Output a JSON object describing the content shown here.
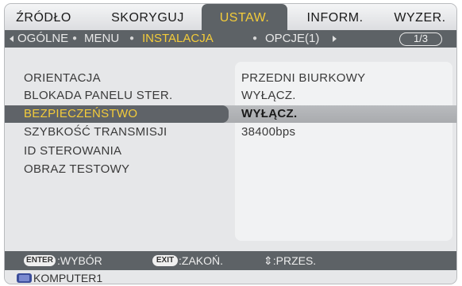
{
  "tabs": [
    "ŹRÓDŁO",
    "SKORYGUJ",
    "USTAW.",
    "INFORM.",
    "WYZER."
  ],
  "subtabs": {
    "items": [
      "OGÓLNE",
      "MENU",
      "INSTALACJA",
      "OPCJE(1)"
    ],
    "page_indicator": "1/3"
  },
  "settings": [
    {
      "label": "ORIENTACJA",
      "value": "PRZEDNI BIURKOWY"
    },
    {
      "label": "BLOKADA PANELU STER.",
      "value": "WYŁĄCZ."
    },
    {
      "label": "BEZPIECZEŃSTWO",
      "value": "WYŁĄCZ."
    },
    {
      "label": "SZYBKOŚĆ TRANSMISJI",
      "value": "38400bps"
    },
    {
      "label": "ID STEROWANIA",
      "value": ""
    },
    {
      "label": "OBRAZ TESTOWY",
      "value": ""
    }
  ],
  "footer": {
    "enter_key": "ENTER",
    "enter_text": ":WYBÓR",
    "exit_key": "EXIT",
    "exit_text": ":ZAKOŃ.",
    "move_text": "⇕:PRZES."
  },
  "source": {
    "icon": "monitor-icon",
    "label": "KOMPUTER1"
  },
  "colors": {
    "highlight": "#f4cc3a",
    "bar": "#5d6266",
    "background": "#e6e7e9"
  }
}
